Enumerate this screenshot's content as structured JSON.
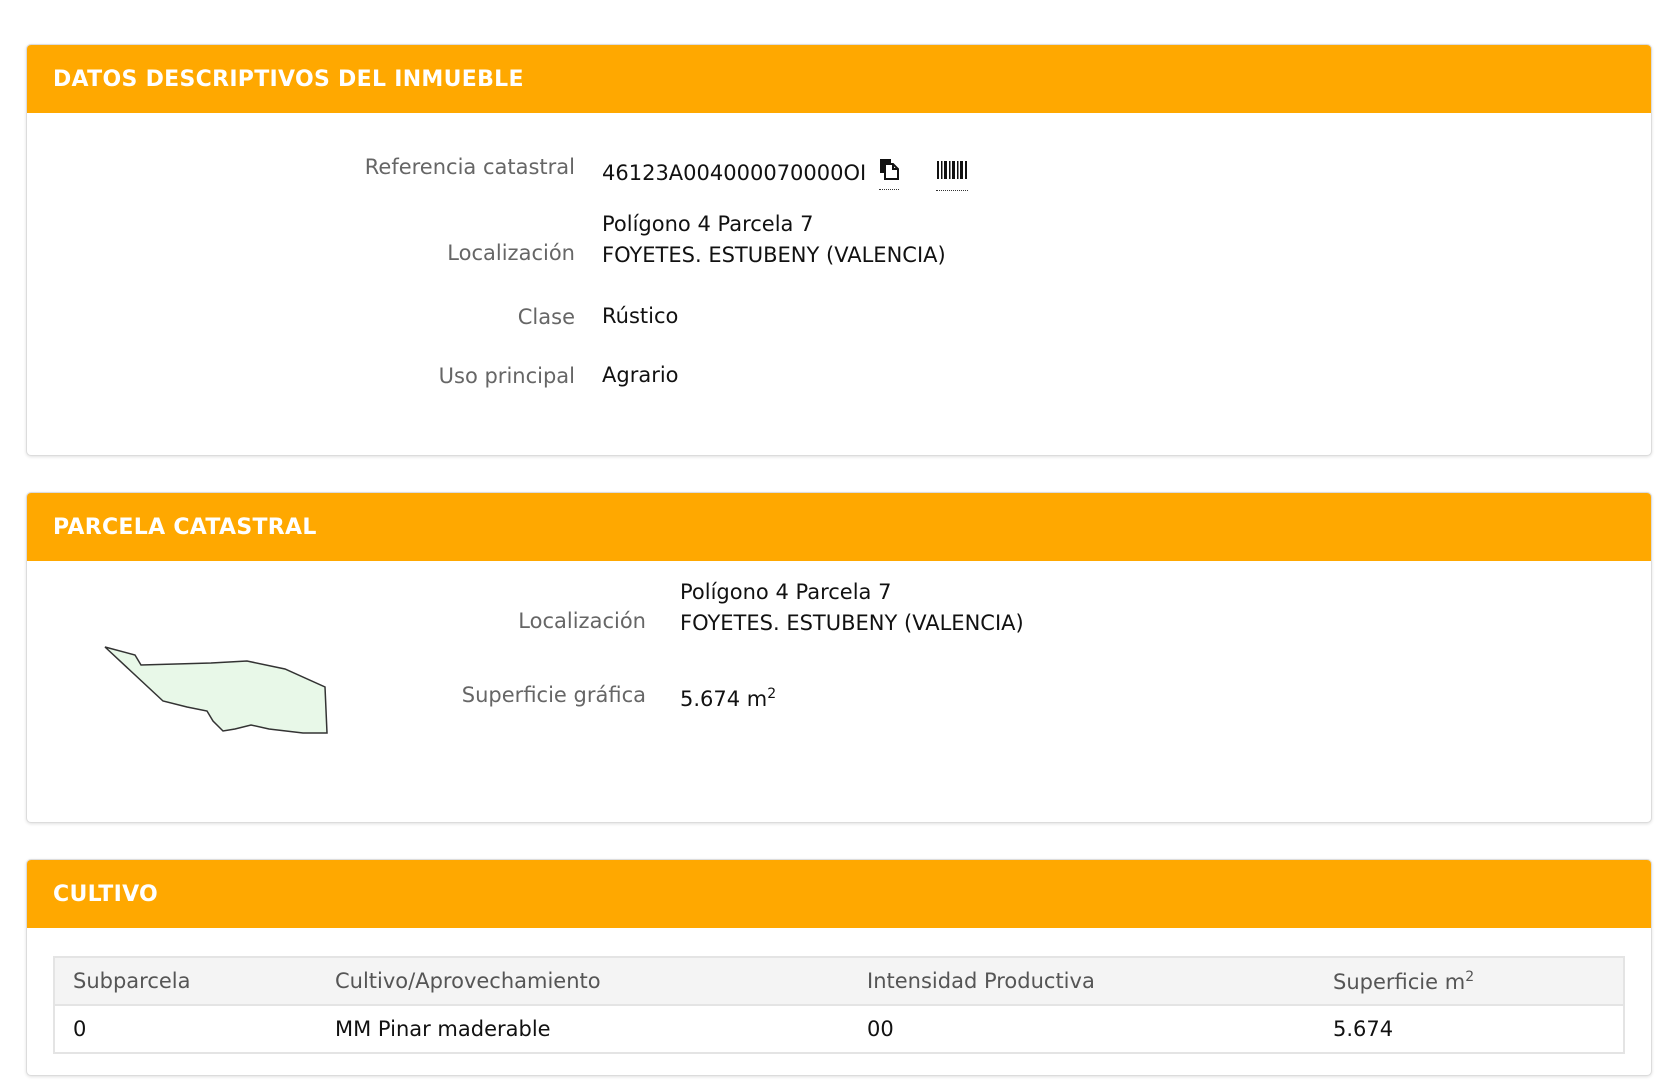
{
  "datos": {
    "title": "DATOS DESCRIPTIVOS DEL INMUEBLE",
    "ref_label": "Referencia catastral",
    "ref_value": "46123A004000070000OI",
    "loc_label": "Localización",
    "loc_line1": "Polígono 4 Parcela 7",
    "loc_line2": "FOYETES. ESTUBENY (VALENCIA)",
    "clase_label": "Clase",
    "clase_value": "Rústico",
    "uso_label": "Uso principal",
    "uso_value": "Agrario"
  },
  "parcela": {
    "title": "PARCELA CATASTRAL",
    "loc_label": "Localización",
    "loc_line1": "Polígono 4 Parcela 7",
    "loc_line2": "FOYETES. ESTUBENY (VALENCIA)",
    "sup_label": "Superficie gráfica",
    "sup_value": "5.674 m",
    "sup_exp": "2",
    "shape_fill": "#e8f8e8",
    "shape_stroke": "#333333"
  },
  "cultivo": {
    "title": "CULTIVO",
    "headers": {
      "subparcela": "Subparcela",
      "cultivo": "Cultivo/Aprovechamiento",
      "intensidad": "Intensidad Productiva",
      "superficie": "Superficie m",
      "superficie_exp": "2"
    },
    "rows": [
      {
        "subparcela": "0",
        "cultivo": "MM Pinar maderable",
        "intensidad": "00",
        "superficie": "5.674"
      }
    ]
  },
  "colors": {
    "header_bg": "#FFA800",
    "header_text": "#FFFFFF"
  },
  "icons": {
    "copy": "copy-icon",
    "barcode": "barcode-icon"
  }
}
